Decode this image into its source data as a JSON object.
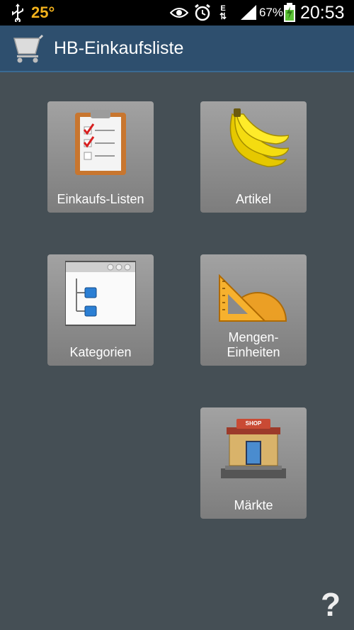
{
  "status_bar": {
    "temperature": "25°",
    "battery_percent": "67%",
    "time": "20:53",
    "network_letter": "E",
    "icons": [
      "usb-icon",
      "eye-icon",
      "alarm-icon",
      "network-arrows-icon",
      "signal-icon",
      "battery-charging-icon"
    ]
  },
  "action_bar": {
    "title": "HB-Einkaufsliste",
    "icon": "shopping-cart-icon"
  },
  "tiles": [
    {
      "label": "Einkaufs-Listen",
      "icon": "checklist-icon"
    },
    {
      "label": "Artikel",
      "icon": "banana-icon"
    },
    {
      "label": "Kategorien",
      "icon": "category-tree-icon"
    },
    {
      "label": "Mengen-\nEinheiten",
      "icon": "ruler-protractor-icon"
    },
    {
      "label": "Märkte",
      "icon": "shop-icon",
      "sign_text": "SHOP"
    }
  ],
  "help": {
    "label": "?",
    "icon": "help-icon"
  },
  "colors": {
    "background": "#454f55",
    "action_bar": "#2e4f6e",
    "tile": "#8f8f8f",
    "temperature": "#f3b21c"
  }
}
